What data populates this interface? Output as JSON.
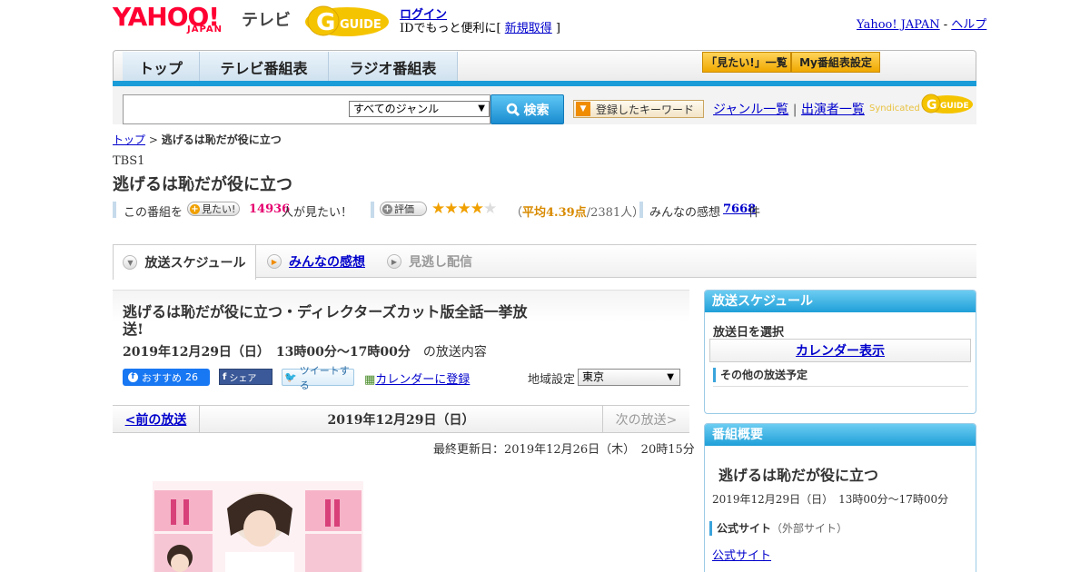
{
  "header": {
    "logo_yahoo": "YAHOO!",
    "logo_japan": "JAPAN",
    "logo_tv": "テレビ",
    "logo_gguide": "G GUIDE",
    "login_label": "ログイン",
    "login_sub_prefix": "IDでもっと便利に[ ",
    "register_label": "新規取得",
    "login_sub_suffix": " ]",
    "yahoo_japan_link": "Yahoo! JAPAN",
    "separator": " - ",
    "help_link": "ヘルプ"
  },
  "nav": {
    "tabs": [
      "トップ",
      "テレビ番組表",
      "ラジオ番組表"
    ],
    "mitai_list": "「見たい!」一覧",
    "my_guide": "My番組表設定"
  },
  "search": {
    "genre_selected": "すべてのジャンル",
    "button_label": "検索",
    "keyword_button": "登録したキーワード",
    "genre_list_link": "ジャンル一覧",
    "divider": "|",
    "performer_list_link": "出演者一覧",
    "syndicated_label": "Syndicated",
    "syndicated_brand": "GUIDE"
  },
  "breadcrumb": {
    "top": "トップ",
    "sep": " > ",
    "current": "逃げるは恥だが役に立つ"
  },
  "program": {
    "channel": "TBS1",
    "title": "逃げるは恥だが役に立つ"
  },
  "stats": {
    "this_program": "この番組を",
    "mitai_pill": "見たい!",
    "mitai_count": "14936",
    "mitai_suffix": "人が見たい！",
    "rate_pill": "評価",
    "rating_value": 4.39,
    "rating_open": "（",
    "rating_avg": "平均4.39点",
    "rating_people": "/2381人）",
    "impressions_label": "みんなの感想",
    "impressions_count": "7668",
    "impressions_suffix": "件"
  },
  "tabs": {
    "schedule": "放送スケジュール",
    "impressions": "みんなの感想",
    "streaming": "見逃し配信"
  },
  "event": {
    "title": "逃げるは恥だが役に立つ・ディレクターズカット版全話一挙放送!",
    "date_bold": "2019年12月29日（日）　13時00分～17時00分",
    "date_suffix": "　の放送内容",
    "fb_label": "おすすめ",
    "fb_count": "26",
    "share_label": "シェア",
    "tweet_label": "ツイートする",
    "calendar_register": "カレンダーに登録",
    "region_label": "地域設定",
    "region_selected": "東京"
  },
  "pager": {
    "prev": "<前の放送",
    "current_date": "2019年12月29日（日）",
    "next": "次の放送>"
  },
  "updated": "最終更新日：2019年12月26日（木）　20時15分",
  "sidebar": {
    "schedule_head": "放送スケジュール",
    "choose_date": "放送日を選択",
    "calendar_display": "カレンダー表示",
    "other_schedule": "その他の放送予定",
    "overview_head": "番組概要",
    "overview_title": "逃げるは恥だが役に立つ",
    "overview_date": "2019年12月29日（日）　13時00分～17時00分",
    "official_site_label": "公式サイト",
    "external_note": "（外部サイト）",
    "official_site_link": "公式サイト"
  },
  "colors": {
    "accent_blue": "#1a9cd8",
    "yahoo_red": "#ff0033",
    "star_gold": "#f0a000",
    "mitai_pink": "#e6006e"
  }
}
